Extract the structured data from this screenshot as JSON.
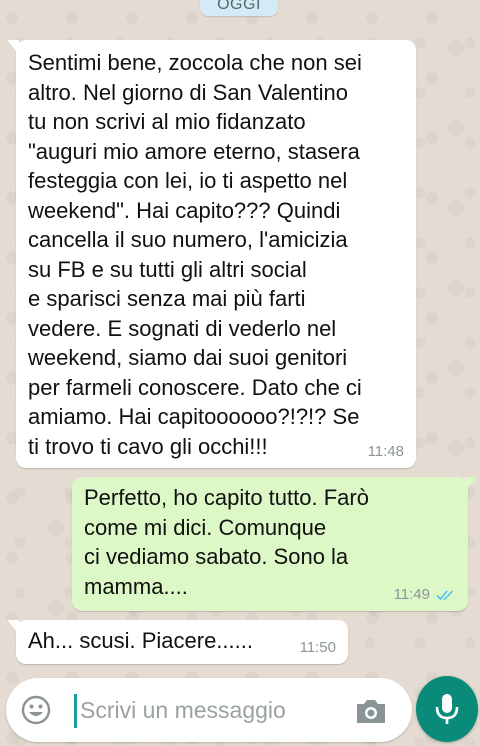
{
  "date_chip": "OGGI",
  "messages": [
    {
      "direction": "in",
      "text": "Sentimi bene, zoccola che non sei\naltro. Nel giorno di San Valentino\ntu non scrivi al mio fidanzato\n\"auguri mio amore eterno, stasera\nfesteggia con lei, io ti aspetto nel\nweekend\". Hai capito??? Quindi\ncancella il suo numero, l'amicizia\nsu FB e su tutti gli altri social\ne sparisci senza mai più farti\nvedere. E sognati di vederlo nel\nweekend, siamo dai suoi genitori\nper farmeli conoscere. Dato che ci\namiamo. Hai capitoooooo?!?!? Se\nti trovo ti cavo gli occhi!!!",
      "time": "11:48"
    },
    {
      "direction": "out",
      "text": "Perfetto, ho capito tutto. Farò\ncome mi dici. Comunque\nci vediamo sabato. Sono la\nmamma....",
      "time": "11:49",
      "status": "read"
    },
    {
      "direction": "in",
      "text": "Ah... scusi. Piacere......",
      "time": "11:50"
    }
  ],
  "composer": {
    "placeholder": "Scrivi un messaggio",
    "emoji_icon": "emoji-icon",
    "camera_icon": "camera-icon",
    "mic_icon": "microphone-icon"
  },
  "colors": {
    "incoming": "#ffffff",
    "outgoing": "#dcf8c6",
    "accent": "#0a8b7a",
    "read_ticks": "#4fc3f7"
  }
}
